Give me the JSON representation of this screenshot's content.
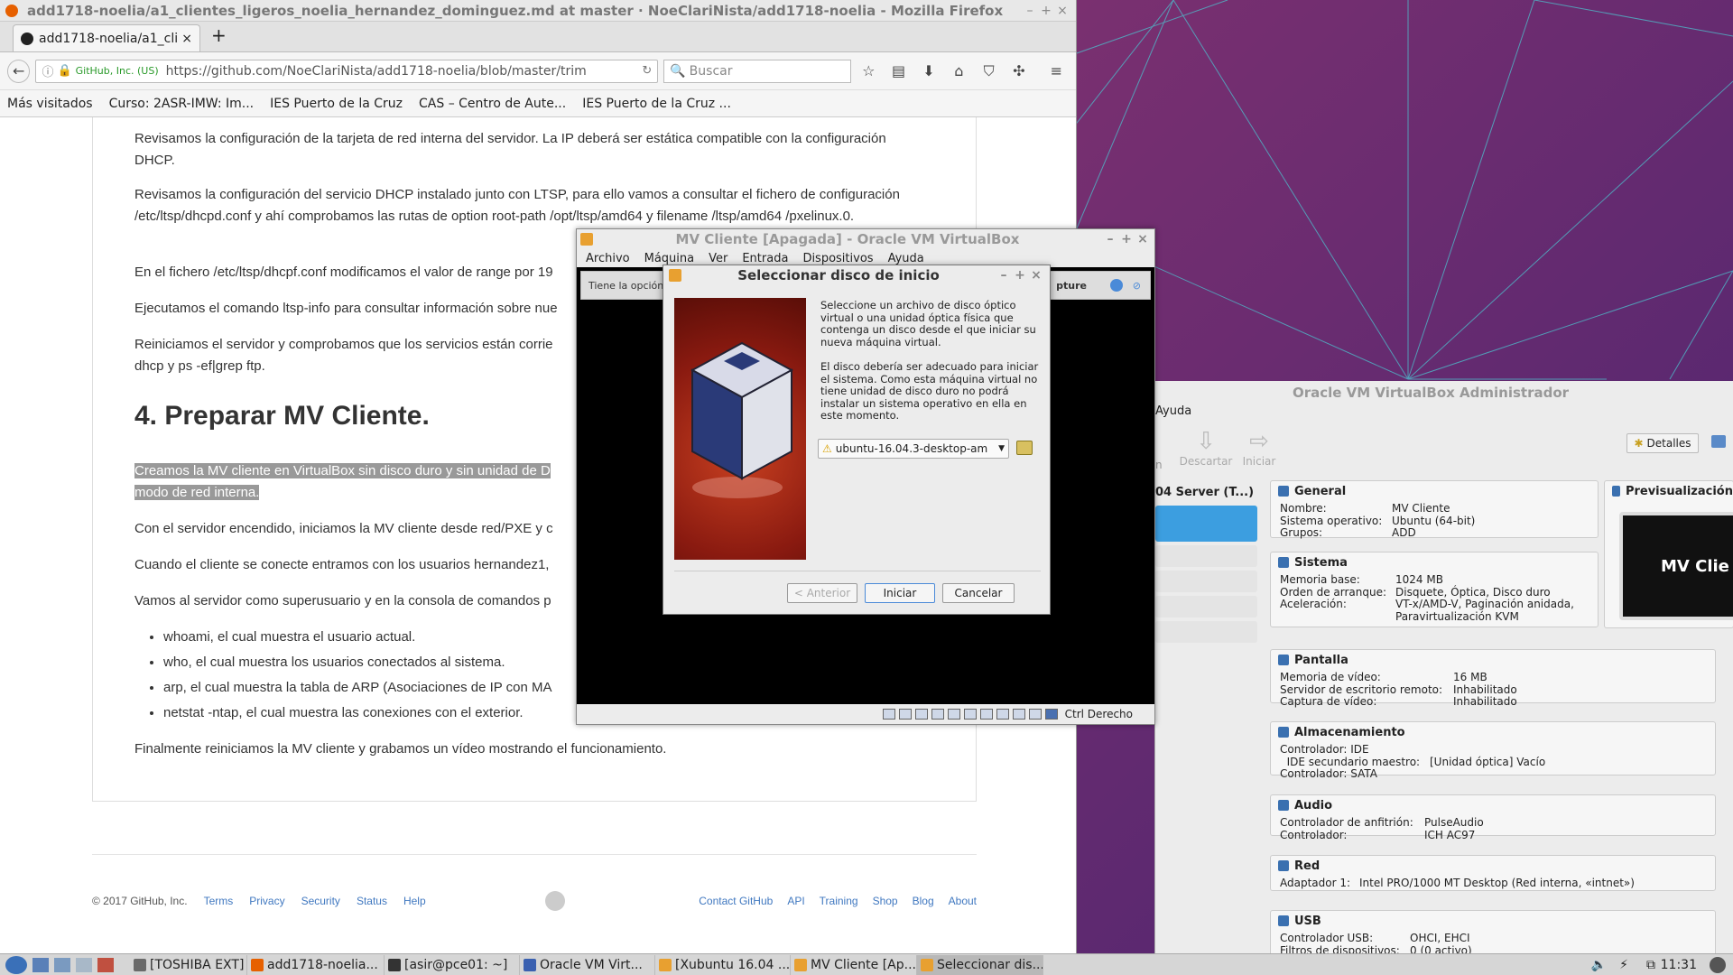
{
  "firefox": {
    "window_title": "add1718-noelia/a1_clientes_ligeros_noelia_hernandez_dominguez.md at master · NoeClariNista/add1718-noelia - Mozilla Firefox",
    "tab_label": "add1718-noelia/a1_cli",
    "identity": "GitHub, Inc. (US)",
    "url": "https://github.com/NoeClariNista/add1718-noelia/blob/master/trim",
    "search_placeholder": "Buscar",
    "bookmarks": [
      "Más visitados",
      "Curso: 2ASR-IMW: Im...",
      "IES Puerto de la Cruz",
      "CAS – Centro de Aute...",
      "IES Puerto de la Cruz ..."
    ]
  },
  "article": {
    "p1": "Revisamos la configuración de la tarjeta de red interna del servidor. La IP deberá ser estática compatible con la configuración DHCP.",
    "p2": "Revisamos la configuración del servicio DHCP instalado junto con LTSP, para ello vamos a consultar el fichero de configuración /etc/ltsp/dhcpd.conf y ahí comprobamos las rutas de option root-path /opt/ltsp/amd64 y filename /ltsp/amd64 /pxelinux.0.",
    "p3": "En el fichero /etc/ltsp/dhcpf.conf modificamos el valor de range por 19",
    "p4": "Ejecutamos el comando ltsp-info para consultar información sobre nue",
    "p5a": "Reiniciamos el servidor y comprobamos que los servicios están corrie",
    "p5b": "dhcp y ps -ef|grep ftp.",
    "heading": "4. Preparar MV Cliente.",
    "p6a": "Creamos la MV cliente en VirtualBox sin disco duro y sin unidad de D",
    "p6b": "modo de red interna.",
    "p7": "Con el servidor encendido, iniciamos la MV cliente desde red/PXE y c",
    "p8": "Cuando el cliente se conecte entramos con los usuarios hernandez1,",
    "p9": "Vamos al servidor como superusuario y en la consola de comandos p",
    "bullets": [
      "whoami, el cual muestra el usuario actual.",
      "who, el cual muestra los usuarios conectados al sistema.",
      "arp, el cual muestra la tabla de ARP (Asociaciones de IP con MA",
      "netstat -ntap, el cual muestra las conexiones con el exterior."
    ],
    "p10": "Finalmente reiniciamos la MV cliente y grabamos un vídeo mostrando el funcionamiento."
  },
  "footer": {
    "copyright": "© 2017 GitHub, Inc.",
    "left_links": [
      "Terms",
      "Privacy",
      "Security",
      "Status",
      "Help"
    ],
    "right_links": [
      "Contact GitHub",
      "API",
      "Training",
      "Shop",
      "Blog",
      "About"
    ]
  },
  "vm_window": {
    "title": "MV Cliente [Apagada] - Oracle VM VirtualBox",
    "menu": [
      "Archivo",
      "Máquina",
      "Ver",
      "Entrada",
      "Dispositivos",
      "Ayuda"
    ],
    "info_left": "Tiene la opción",
    "info_right": "pture",
    "host_key": "Ctrl Derecho"
  },
  "dialog": {
    "title": "Seleccionar disco de inicio",
    "text1": "Seleccione un archivo de disco óptico virtual o una unidad óptica física que contenga un disco desde el que iniciar su nueva máquina virtual.",
    "text2": "El disco debería ser adecuado para iniciar el sistema. Como esta máquina virtual no tiene unidad de disco duro no podrá instalar un sistema operativo en ella en este momento.",
    "combo_value": "ubuntu-16.04.3-desktop-am",
    "btn_back": "< Anterior",
    "btn_start": "Iniciar",
    "btn_cancel": "Cancelar"
  },
  "manager": {
    "title": "Oracle VM VirtualBox Administrador",
    "menu_help": "Ayuda",
    "tool_discard": "Descartar",
    "tool_start": "Iniciar",
    "details_btn": "Detalles",
    "preview_title": "Previsualización",
    "preview_label": "MV Clie",
    "list_item": "04 Server (T...)",
    "sections": {
      "general": {
        "title": "General",
        "rows": [
          [
            "Nombre:",
            "MV Cliente"
          ],
          [
            "Sistema operativo:",
            "Ubuntu (64-bit)"
          ],
          [
            "Grupos:",
            "ADD"
          ]
        ]
      },
      "system": {
        "title": "Sistema",
        "rows": [
          [
            "Memoria base:",
            "1024 MB"
          ],
          [
            "Orden de arranque:",
            "Disquete, Óptica, Disco duro"
          ],
          [
            "Aceleración:",
            "VT-x/AMD-V, Paginación anidada,"
          ],
          [
            "",
            "Paravirtualización KVM"
          ]
        ]
      },
      "display": {
        "title": "Pantalla",
        "rows": [
          [
            "Memoria de vídeo:",
            "16 MB"
          ],
          [
            "Servidor de escritorio remoto:",
            "Inhabilitado"
          ],
          [
            "Captura de vídeo:",
            "Inhabilitado"
          ]
        ]
      },
      "storage": {
        "title": "Almacenamiento",
        "rows": [
          [
            "Controlador: IDE",
            ""
          ],
          [
            "  IDE secundario maestro:",
            "[Unidad óptica] Vacío"
          ],
          [
            "Controlador: SATA",
            ""
          ]
        ]
      },
      "audio": {
        "title": "Audio",
        "rows": [
          [
            "Controlador de anfitrión:",
            "PulseAudio"
          ],
          [
            "Controlador:",
            "ICH AC97"
          ]
        ]
      },
      "network": {
        "title": "Red",
        "rows": [
          [
            "Adaptador 1:",
            "Intel PRO/1000 MT Desktop (Red interna, «intnet»)"
          ]
        ]
      },
      "usb": {
        "title": "USB",
        "rows": [
          [
            "Controlador USB:",
            "OHCI, EHCI"
          ],
          [
            "Filtros de dispositivos:",
            "0 (0 activo)"
          ]
        ]
      }
    }
  },
  "taskbar": {
    "items": [
      "[TOSHIBA EXT]",
      "add1718-noelia...",
      "[asir@pce01: ~]",
      "Oracle VM Virt...",
      "[Xubuntu 16.04 ...",
      "MV Cliente [Ap...",
      "Seleccionar dis..."
    ],
    "clock": "11:31"
  }
}
